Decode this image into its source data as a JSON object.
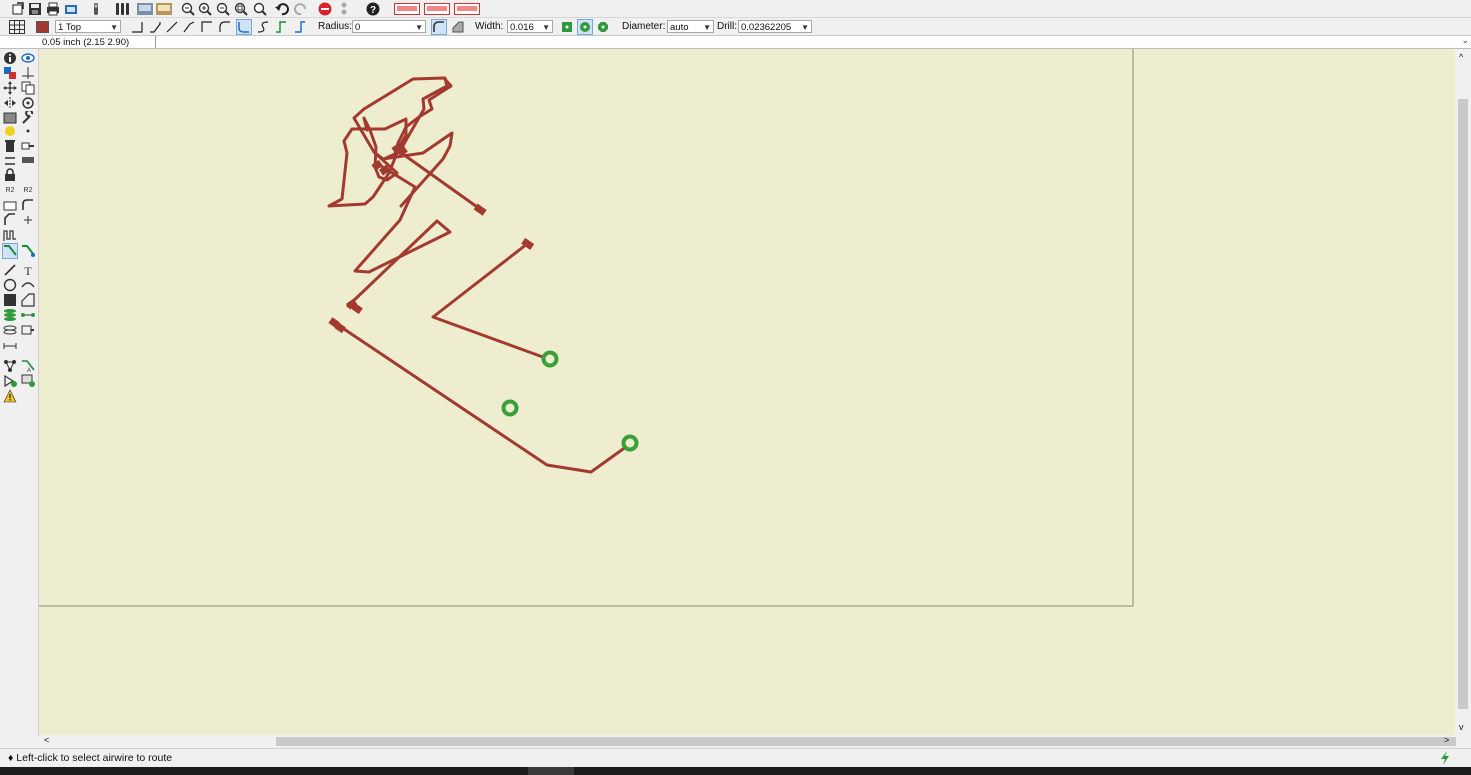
{
  "toolbar1": {
    "icons": [
      "open-icon",
      "save-icon",
      "print-icon",
      "cam-icon",
      "ulp-icon",
      "script-icon",
      "board-icon",
      "schematic-icon",
      "zoom-fit-icon",
      "zoom-in-icon",
      "zoom-out-icon",
      "zoom-select-icon",
      "redraw-icon",
      "undo-icon",
      "redo-icon",
      "stop-icon",
      "go-icon",
      "help-icon",
      "design-link-icon",
      "pcb-quote-icon",
      "pdf-icon"
    ]
  },
  "toolbar2": {
    "layer_color": "#a03a30",
    "layer_value": "1 Top",
    "bend_styles": [
      "bend-90",
      "bend-45",
      "bend-free",
      "bend-135",
      "bend-90-corner",
      "bend-arc-corner",
      "bend-arc-45",
      "bend-s",
      "bend-route-1",
      "bend-route-2"
    ],
    "radius_label": "Radius:",
    "radius_value": "0",
    "width_label": "Width:",
    "width_value": "0.016",
    "diameter_label": "Diameter:",
    "diameter_value": "auto",
    "drill_label": "Drill:",
    "drill_value": "0.02362205"
  },
  "command": {
    "grid_text": "0.05 inch (2.15 2.90)",
    "input_value": ""
  },
  "status": {
    "message": "♦ Left-click to select airwire to route"
  },
  "colors": {
    "canvas": "#efedcf",
    "trace": "#a33a30",
    "via": "#3aa03a",
    "board_outline": "#8a8a7a"
  },
  "tools_left": [
    "info-icon",
    "show-icon",
    "display-icon",
    "mark-icon",
    "move-icon",
    "copy-icon",
    "mirror-icon",
    "rotate-icon",
    "group-icon",
    "change-icon",
    "paste-icon",
    "delete-icon",
    "add-icon",
    "replace-icon",
    "lock-icon",
    "name-icon",
    "value-icon",
    "smash-icon",
    "split-icon",
    "miter-icon",
    "optimize-icon",
    "meander-icon",
    "route-icon",
    "ripup-icon",
    "wire-icon",
    "text-icon",
    "circle-icon",
    "arc-icon",
    "rect-icon",
    "polygon-icon",
    "via-icon",
    "signal-icon",
    "hole-icon",
    "attribute-icon",
    "dimension-icon",
    "ratsnest-icon",
    "autorouter-icon",
    "drc-icon",
    "erc-icon",
    "errors-icon"
  ]
}
